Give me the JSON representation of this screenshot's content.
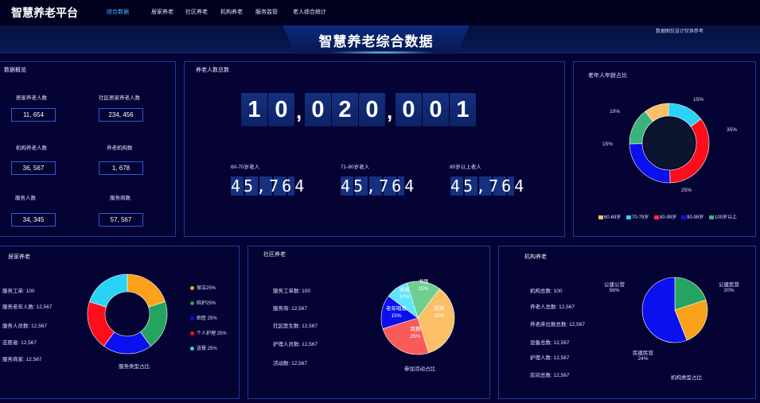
{
  "brand": "智慧养老平台",
  "nav": [
    "综合数据",
    "居家养老",
    "社区养老",
    "机构养老",
    "服务监管",
    "老人综合统计"
  ],
  "banner": {
    "title": "智慧养老综合数据",
    "note": "数据图仅设计仅供参考"
  },
  "overview": {
    "title": "数据概览",
    "items": [
      {
        "label": "居家养老人数",
        "value": "11, 654"
      },
      {
        "label": "社区居家养老人数",
        "value": "234, 456"
      },
      {
        "label": "机构养老人数",
        "value": "36, 567"
      },
      {
        "label": "养老机构数",
        "value": "1, 678"
      },
      {
        "label": "服务人数",
        "value": "34, 345"
      },
      {
        "label": "服务商数",
        "value": "57, 567"
      }
    ]
  },
  "total": {
    "title": "养老人数总数",
    "digits": [
      "1",
      "0",
      "0",
      "2",
      "0",
      "0",
      "0",
      "1"
    ],
    "groups": [
      {
        "label": "60-70岁老人",
        "value": "45,764"
      },
      {
        "label": "71-80岁老人",
        "value": "45,764"
      },
      {
        "label": "80岁以上老人",
        "value": "45,764"
      }
    ]
  },
  "colors": {
    "yellow": "#fbbf66",
    "cyan": "#29d3f5",
    "red": "#ff0d1a",
    "blue": "#0a10ee",
    "green": "#3bb27a",
    "orange": "#f9a21a",
    "green2": "#25a461",
    "pink": "#fb5a5a",
    "lightblue": "#5ee5ff",
    "navy": "#020130"
  },
  "age_chart": {
    "title": "老年人年龄占比",
    "legend": [
      "60-69岁",
      "70-79岁",
      "80-99岁",
      "90-99岁",
      "100岁以上"
    ],
    "labels": [
      "10%",
      "15%",
      "35%",
      "25%",
      "15%"
    ]
  },
  "home": {
    "title": "居家养老",
    "stats": [
      {
        "label": "服务工单:",
        "value": "100"
      },
      {
        "label": "服务老年人数:",
        "value": "12,567"
      },
      {
        "label": "服务人员数:",
        "value": "12,567"
      },
      {
        "label": "志愿者:",
        "value": "12,567"
      },
      {
        "label": "服务商家:",
        "value": "12,567"
      }
    ],
    "legend": [
      "保洁25%",
      "陪护25%",
      "助医 25%",
      "个人护理 25%",
      "送餐 25%"
    ],
    "chart_title": "服务类型占比"
  },
  "community": {
    "title": "社区养老",
    "stats": [
      {
        "label": "服务工单数:",
        "value": "100"
      },
      {
        "label": "服务商:",
        "value": "12,567"
      },
      {
        "label": "社区医生数:",
        "value": "12,567"
      },
      {
        "label": "护理人员数:",
        "value": "12,567"
      },
      {
        "label": "活动数:",
        "value": "12,567"
      }
    ],
    "slices": [
      {
        "name": "书画",
        "pct": "15%"
      },
      {
        "name": "棋类",
        "pct": "35%"
      },
      {
        "name": "跳舞",
        "pct": "25%"
      },
      {
        "name": "老年唱歌",
        "pct": "15%"
      },
      {
        "name": "瑜伽",
        "pct": "10%"
      }
    ],
    "chart_title": "参加活动占比"
  },
  "institution": {
    "title": "机构养老",
    "stats": [
      {
        "label": "机构总数:",
        "value": "100"
      },
      {
        "label": "养老人总数:",
        "value": "12,567"
      },
      {
        "label": "养老床位数总数:",
        "value": "12,567"
      },
      {
        "label": "设备总数:",
        "value": "12,567"
      },
      {
        "label": "护理人数:",
        "value": "12,567"
      },
      {
        "label": "房间总数:",
        "value": "12,567"
      }
    ],
    "slices": [
      {
        "name": "公建公营",
        "pct": "56%"
      },
      {
        "name": "公建民营",
        "pct": "20%"
      },
      {
        "name": "民建民营",
        "pct": "24%"
      }
    ],
    "chart_title": "机构类型占比"
  }
}
